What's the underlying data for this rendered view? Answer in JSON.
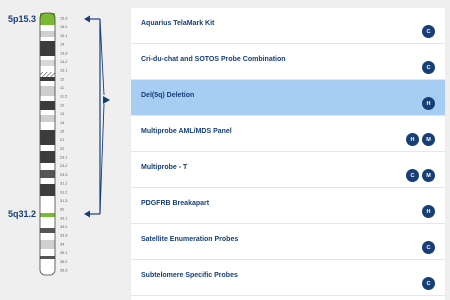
{
  "chromosome": {
    "band_top_label": "5p15.3",
    "band_bottom_label": "5q31.2",
    "band_ticks": [
      "15.3",
      "15.2",
      "15.1",
      "14",
      "13.3",
      "13.2",
      "13.1",
      "12",
      "11",
      "11.2",
      "12",
      "13",
      "14",
      "15",
      "21",
      "22",
      "23.1",
      "23.2",
      "23.3",
      "31.1",
      "31.2",
      "31.3",
      "32",
      "33.1",
      "33.2",
      "33.3",
      "34",
      "35.1",
      "35.2",
      "35.3"
    ],
    "highlight_color": "#7cb832",
    "arrow_color": "#173f77"
  },
  "probes": [
    {
      "title": "Aquarius TelaMark Kit",
      "badges": [
        "C"
      ],
      "selected": false
    },
    {
      "title": "Cri-du-chat and SOTOS Probe Combination",
      "badges": [
        "C"
      ],
      "selected": false
    },
    {
      "title": "Del(5q) Deletion",
      "badges": [
        "H"
      ],
      "selected": true
    },
    {
      "title": "Multiprobe AML/MDS Panel",
      "badges": [
        "H",
        "M"
      ],
      "selected": false
    },
    {
      "title": "Multiprobe - T",
      "badges": [
        "C",
        "M"
      ],
      "selected": false
    },
    {
      "title": "PDGFRB Breakapart",
      "badges": [
        "H"
      ],
      "selected": false
    },
    {
      "title": "Satellite Enumeration Probes",
      "badges": [
        "C"
      ],
      "selected": false
    },
    {
      "title": "Subtelomere Specific Probes",
      "badges": [
        "C"
      ],
      "selected": false
    }
  ]
}
